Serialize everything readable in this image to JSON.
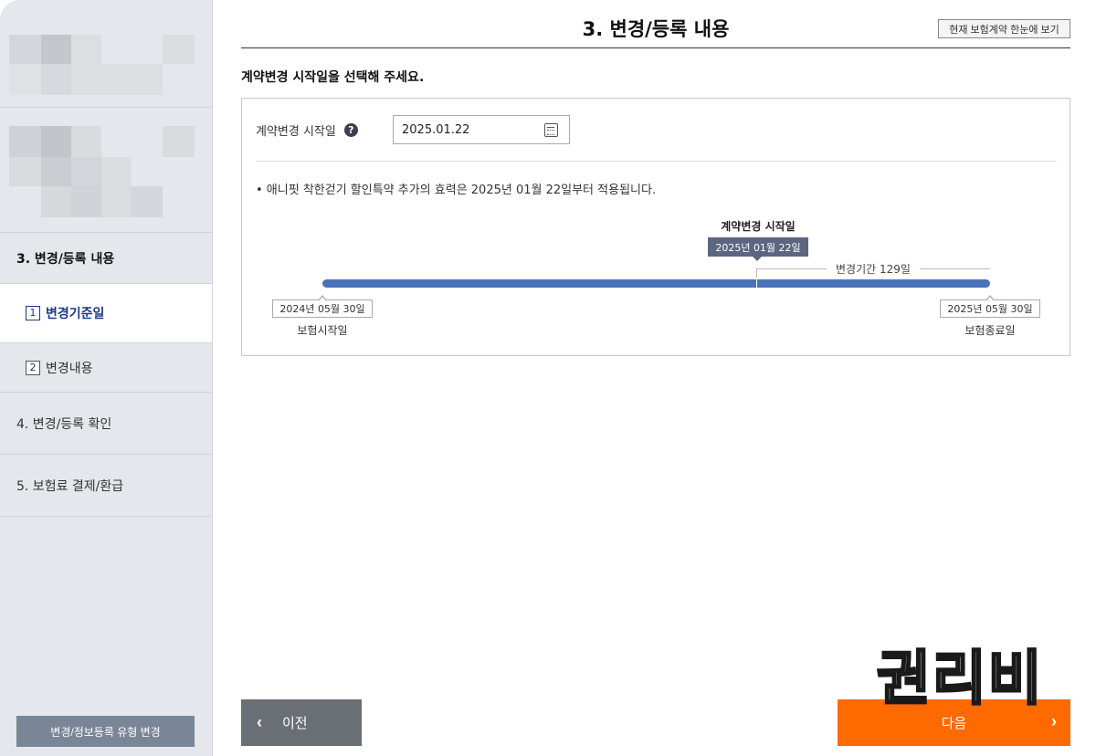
{
  "sidebar": {
    "steps": [
      {
        "label": "3. 변경/등록 내용"
      },
      {
        "label": "4. 변경/등록 확인"
      },
      {
        "label": "5. 보험료 결제/환급"
      }
    ],
    "substeps": [
      {
        "num": "1",
        "label": "변경기준일",
        "active": true
      },
      {
        "num": "2",
        "label": "변경내용",
        "active": false
      }
    ],
    "type_change_button": "변경/정보등록 유형 변경"
  },
  "header": {
    "title": "3. 변경/등록 내용",
    "summary_button": "현재 보험계약 한눈에 보기"
  },
  "main": {
    "heading": "계약변경 시작일을 선택해 주세요.",
    "field_label": "계약변경 시작일",
    "help_icon": "question-circle-icon",
    "date_value": "2025.01.22",
    "calendar_icon": "calendar-icon",
    "notice": "• 애니핏 착한걷기 할인특약 추가의 효력은 2025년 01월 22일부터 적용됩니다."
  },
  "timeline": {
    "marker_caption": "계약변경 시작일",
    "marker_date": "2025년 01월 22일",
    "period_label": "변경기간 129일",
    "start_date": "2024년 05월 30일",
    "start_label": "보험시작일",
    "end_date": "2025년 05월 30일",
    "end_label": "보험종료일",
    "marker_fraction": 0.65,
    "bar_color": "#4a72b8"
  },
  "footer": {
    "prev_label": "이전",
    "next_label": "다음",
    "prev_icon": "chevron-left-icon",
    "next_icon": "chevron-right-icon",
    "next_color": "#ff6a00"
  },
  "watermark": "권리비"
}
